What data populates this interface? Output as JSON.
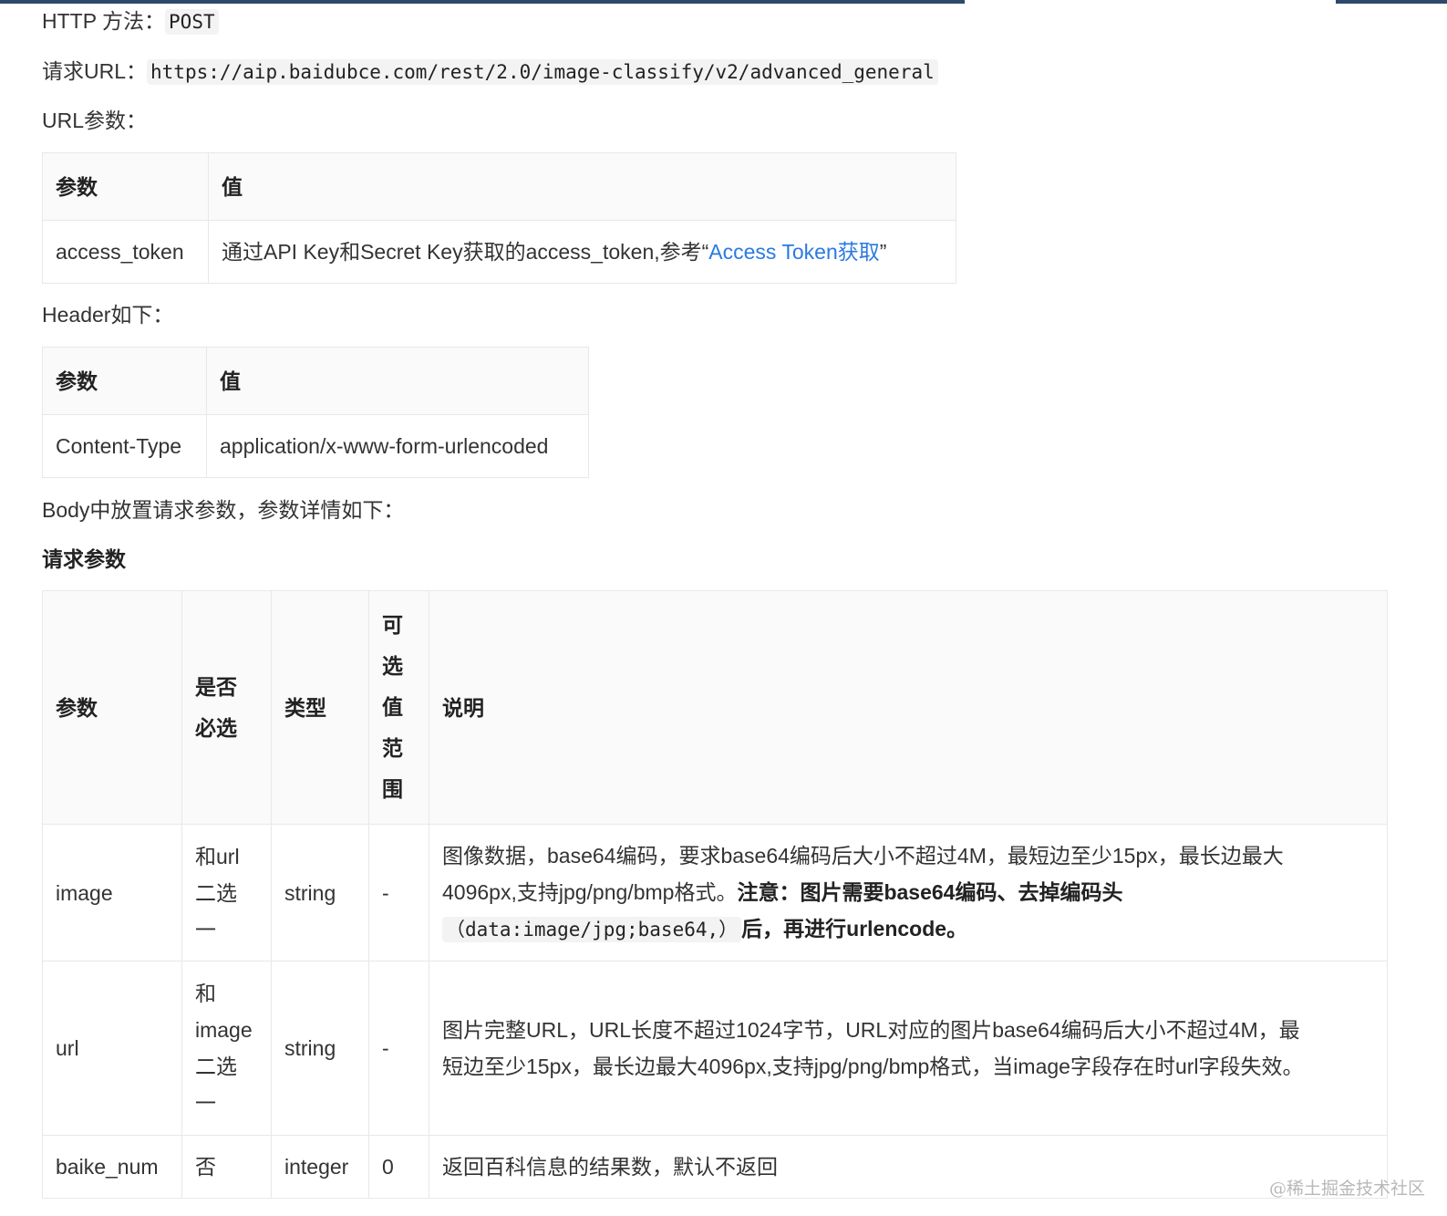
{
  "http_method": {
    "label": "HTTP 方法：",
    "value": "POST"
  },
  "request_url": {
    "label": "请求URL：",
    "value": "https://aip.baidubce.com/rest/2.0/image-classify/v2/advanced_general"
  },
  "url_params": {
    "title": "URL参数：",
    "headers": [
      "参数",
      "值"
    ],
    "row": {
      "param": "access_token",
      "desc_prefix": "通过API Key和Secret Key获取的access_token,参考“",
      "link": "Access Token获取",
      "desc_suffix": "”"
    }
  },
  "header_params": {
    "title": "Header如下：",
    "headers": [
      "参数",
      "值"
    ],
    "row": {
      "param": "Content-Type",
      "value": "application/x-www-form-urlencoded"
    }
  },
  "body_intro": "Body中放置请求参数，参数详情如下：",
  "request_params": {
    "title": "请求参数",
    "headers": {
      "param": "参数",
      "required_1": "是否",
      "required_2": "必选",
      "type": "类型",
      "range": [
        "可",
        "选",
        "值",
        "范",
        "围"
      ],
      "desc": "说明"
    },
    "rows": [
      {
        "param": "image",
        "required": [
          "和url",
          "二选",
          "一"
        ],
        "type": "string",
        "range": "-",
        "desc_1": "图像数据，base64编码，要求base64编码后大小不超过4M，最短边至少15px，最长边最大",
        "desc_2": "4096px,支持jpg/png/bmp格式。",
        "desc_bold_1": "注意：图片需要base64编码、去掉编码头",
        "desc_code": "（data:image/jpg;base64,）",
        "desc_bold_2": "后，再进行urlencode。"
      },
      {
        "param": "url",
        "required": [
          "和",
          "image",
          "二选",
          "一"
        ],
        "type": "string",
        "range": "-",
        "desc_1": "图片完整URL，URL长度不超过1024字节，URL对应的图片base64编码后大小不超过4M，最",
        "desc_2": "短边至少15px，最长边最大4096px,支持jpg/png/bmp格式，当image字段存在时url字段失效。"
      },
      {
        "param": "baike_num",
        "required": [
          "否"
        ],
        "type": "integer",
        "range": "0",
        "desc_1": "返回百科信息的结果数，默认不返回"
      }
    ]
  },
  "watermark": "@稀土掘金技术社区",
  "colors": {
    "link": "#2a7ae2",
    "header_bg": "#fafafa",
    "border": "#e8e8e8",
    "top_bar": "#2e4a6b"
  }
}
